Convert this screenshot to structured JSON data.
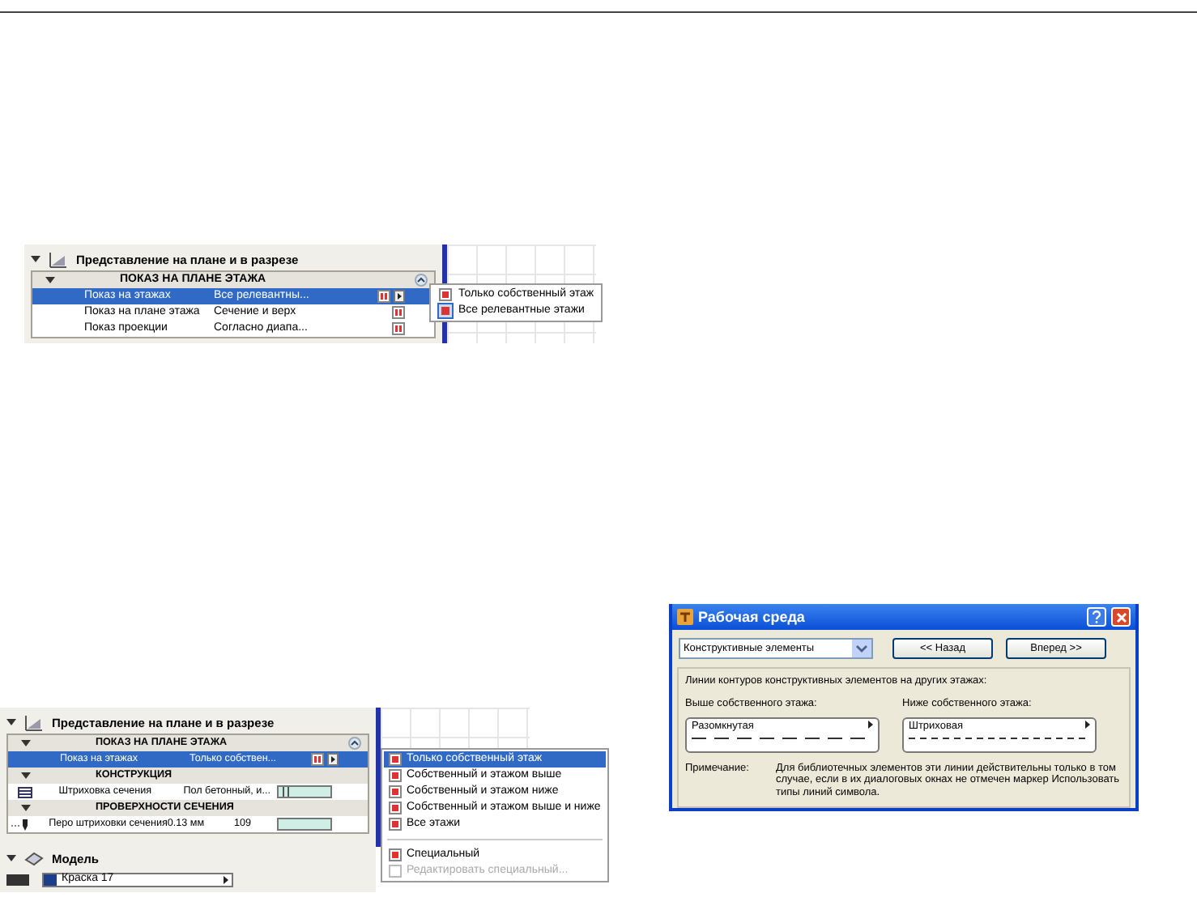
{
  "panel_1": {
    "title": "Представление на плане и в разрезе",
    "groups": [
      {
        "title": "ПОКАЗ НА ПЛАНЕ ЭТАЖА",
        "expanded": true,
        "rows": [
          {
            "kind": "option",
            "label": "Показ на этажах",
            "value": "Все релевантны...",
            "selected": true
          },
          {
            "kind": "option",
            "label": "Показ на плане этажа",
            "value": "Сечение и верх",
            "selected": false
          },
          {
            "kind": "option",
            "label": "Показ проекции",
            "value": "Согласно диапа...",
            "selected": false
          }
        ]
      }
    ],
    "menu": {
      "items": [
        {
          "kind": "item",
          "label": "Только собственный этаж",
          "selected": false,
          "checked": false
        },
        {
          "kind": "item",
          "label": "Все релевантные этажи",
          "selected": false,
          "checked": true
        }
      ]
    }
  },
  "panel_2": {
    "title": "Представление на плане и в разрезе",
    "groups": [
      {
        "title": "ПОКАЗ НА ПЛАНЕ ЭТАЖА",
        "expanded": true,
        "rows": [
          {
            "kind": "option",
            "label": "Показ на этажах",
            "value": "Только собствен...",
            "selected": true
          }
        ]
      },
      {
        "title": "КОНСТРУКЦИЯ",
        "expanded": true,
        "rows": [
          {
            "kind": "fill",
            "label": "Штриховка сечения",
            "value": "Пол бетонный, и...",
            "selected": false
          }
        ]
      },
      {
        "title": "ПРОВЕРХНОСТИ СЕЧЕНИЯ",
        "expanded": true,
        "rows": [
          {
            "kind": "pen",
            "label": "Перо штриховки сечения",
            "value": "0.13 мм",
            "number": "109",
            "selected": false
          }
        ]
      }
    ],
    "section_2": {
      "title": "Модель",
      "dropdown": "Краска 17"
    },
    "menu": {
      "items": [
        {
          "kind": "item",
          "label": "Только собственный этаж",
          "selected": true,
          "disabled": false
        },
        {
          "kind": "item",
          "label": "Собственный и этажом выше",
          "selected": false,
          "disabled": false
        },
        {
          "kind": "item",
          "label": "Собственный и этажом ниже",
          "selected": false,
          "disabled": false
        },
        {
          "kind": "item",
          "label": "Собственный и этажом выше и ниже",
          "selected": false,
          "disabled": false
        },
        {
          "kind": "item",
          "label": "Все этажи",
          "selected": false,
          "disabled": false
        },
        {
          "kind": "separator"
        },
        {
          "kind": "item",
          "label": "Специальный",
          "selected": false,
          "disabled": false
        },
        {
          "kind": "item",
          "label": "Редактировать специальный...",
          "selected": false,
          "disabled": true
        }
      ]
    }
  },
  "dialog": {
    "title": "Рабочая среда",
    "category": "Конструктивные элементы",
    "buttons": [
      "<< Назад",
      "Вперед >>"
    ],
    "heading": "Линии контуров конструктивных элементов на других этажах:",
    "pickers": [
      {
        "label": "Выше собственного этажа:",
        "value": "Разомкнутая",
        "kind": "long-dash"
      },
      {
        "label": "Ниже собственного этажа:",
        "value": "Штриховая",
        "kind": "short-dash"
      }
    ],
    "note_label": "Примечание:",
    "note": "Для библиотечных элементов эти линии действительны только в том случае, если в их диалоговых окнах не отмечен маркер Использовать типы линий символа."
  }
}
